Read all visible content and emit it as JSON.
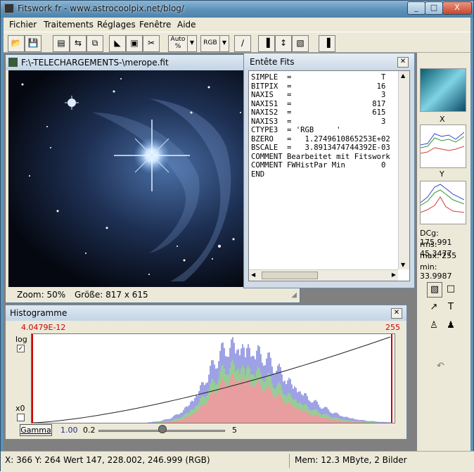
{
  "window": {
    "title": "Fitswork fr - www.astrocoolpix.net/blog/",
    "controls": [
      "_",
      "□",
      "X"
    ]
  },
  "menu": [
    "Fichier",
    "Traitements",
    "Réglages",
    "Fenêtre",
    "Aide"
  ],
  "toolbar": {
    "auto_label": "Auto\n%",
    "rgb_label": "RGB"
  },
  "image_window": {
    "title": "F:\\-TELECHARGEMENTS-\\merope.fit",
    "zoom": "Zoom: 50%",
    "size": "Größe: 817 x 615"
  },
  "header_window": {
    "title": "Entête Fits",
    "lines": [
      "SIMPLE  =                    T",
      "BITPIX  =                   16",
      "NAXIS   =                    3",
      "NAXIS1  =                  817",
      "NAXIS2  =                  615",
      "NAXIS3  =                    3",
      "CTYPE3  = 'RGB     '",
      "BZERO   =   1.2749610865253E+02",
      "BSCALE  =   3.8913474744392E-03",
      "COMMENT Bearbeitet mit Fitswork",
      "COMMENT FWHistPar Min        0",
      "END"
    ]
  },
  "right_panel": {
    "x_label": "X",
    "y_label": "Y",
    "dcg": "DCg: 175.991",
    "rms": "rms: 45.3477",
    "max": "max: 255",
    "min": "min: 33.9987"
  },
  "histogram_window": {
    "title": "Histogramme",
    "min_value": "4.0479E-12",
    "max_value": "255",
    "log_label": "log",
    "x0_label": "x0",
    "gamma_button": "Gamma",
    "gamma_value": "1.00",
    "slider_min": "0.2",
    "slider_max": "5"
  },
  "status_bar": {
    "coords": "X: 366  Y: 264  Wert 147, 228.002, 246.999 (RGB)",
    "memory": "Mem:  12.3 MByte, 2 Bilder"
  },
  "colors": {
    "title_blue": "#5f93ba",
    "red_marker": "#cc0000",
    "blue_series": "#3c45c9",
    "green_series": "#2f9a2f",
    "red_series": "#d23c3c"
  }
}
